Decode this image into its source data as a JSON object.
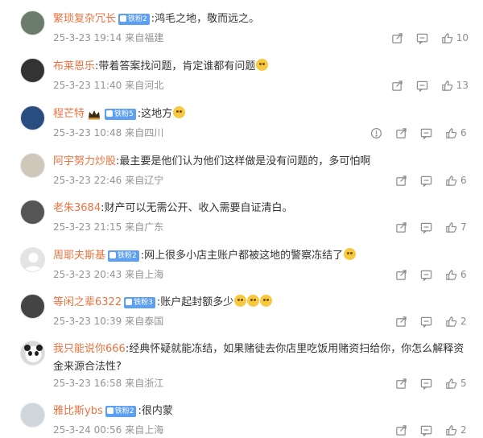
{
  "comments": [
    {
      "name": "繁琐复杂冗长",
      "badge": "铁粉2",
      "text": ":鸿毛之地，敬而远之。",
      "date": "25-3-23 19:14",
      "location": "来自福建",
      "likes": "10",
      "emoji": false,
      "report": false,
      "crown": false
    },
    {
      "name": "布莱恩乐",
      "badge": "",
      "text": ":带着答案找问题，肯定谁都有问题",
      "date": "25-3-23 11:40",
      "location": "来自河北",
      "likes": "13",
      "emoji": true,
      "report": false,
      "crown": false
    },
    {
      "name": "程芒特",
      "badge": "铁粉5",
      "text": ":这地方",
      "date": "25-3-23 10:48",
      "location": "来自四川",
      "likes": "6",
      "emoji": true,
      "report": true,
      "crown": true
    },
    {
      "name": "阿宇努力炒股",
      "badge": "",
      "text": ":最主要是他们认为他们这样做是没有问题的，多可怕啊",
      "date": "25-3-23 22:46",
      "location": "来自辽宁",
      "likes": "6",
      "emoji": false,
      "report": false,
      "crown": false
    },
    {
      "name": "老朱3684",
      "badge": "",
      "text": ":财产可以无需公开、收入需要自证清白。",
      "date": "25-3-23 21:15",
      "location": "来自广东",
      "likes": "7",
      "emoji": false,
      "report": false,
      "crown": false
    },
    {
      "name": "周耶夫斯基",
      "badge": "铁粉2",
      "text": ":网上很多小店主账户都被这地的警察冻结了",
      "date": "25-3-23 20:43",
      "location": "来自上海",
      "likes": "6",
      "emoji": true,
      "report": false,
      "crown": false
    },
    {
      "name": "等闲之辈6322",
      "badge": "铁粉3",
      "text": ":账户起封额多少",
      "date": "25-3-23 10:39",
      "location": "来自泰国",
      "likes": "2",
      "emoji": true,
      "emoji_count": 3,
      "report": false,
      "crown": false
    },
    {
      "name": "我只能说你666",
      "badge": "",
      "text": ":经典怀疑就能冻结，如果赌徒去你店里吃饭用赌资扫给你，你怎么解释资金来源合法性?",
      "date": "25-3-23 16:58",
      "location": "来自浙江",
      "likes": "5",
      "emoji": false,
      "report": false,
      "crown": false
    },
    {
      "name": "雅比斯ybs",
      "badge": "铁粉2",
      "text": ":很内蒙",
      "date": "25-3-24 00:56",
      "location": "来自上海",
      "likes": "2",
      "emoji": false,
      "report": false,
      "crown": false
    }
  ],
  "colors": {
    "name": "#eb7340",
    "badge": "#5d9ff0",
    "meta": "#939393"
  }
}
